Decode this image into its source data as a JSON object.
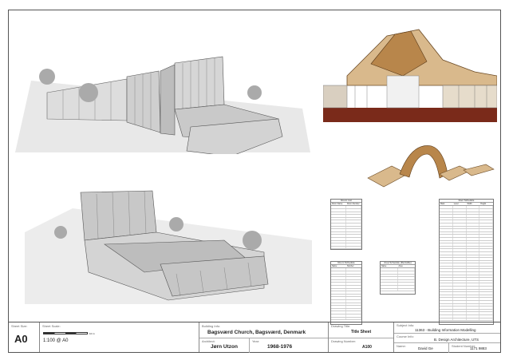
{
  "sheet": {
    "size_caption": "Sheet Size:",
    "size": "A0",
    "scale_caption": "Sheet Scale:",
    "scale": "1:100 @ A0",
    "scalebar_label": "10 m"
  },
  "building": {
    "caption": "Building Info:",
    "name": "Bagsværd Church, Bagsværd, Denmark",
    "architect_caption": "Architect:",
    "architect": "Jørn Utzon",
    "year_caption": "Year:",
    "year": "1968-1976"
  },
  "drawing": {
    "caption": "Drawing Title:",
    "title": "Title Sheet",
    "number_caption": "Drawing Number:",
    "number": "A100"
  },
  "subject": {
    "caption": "Subject Info:",
    "name": "11363 - Building Information Modelling",
    "course_caption": "Course Info:",
    "course": "B. Design Architecture, UTS",
    "name_caption": "Name:",
    "student": "David Ge",
    "id_caption": "Student Number:",
    "student_id": "1171 9883"
  },
  "tables": {
    "rooms": {
      "title": "Room List",
      "headers": [
        "Room Name",
        "Room Number"
      ],
      "rows": 17
    },
    "doors": {
      "title": "Door Schedule",
      "headers": [
        "Mark",
        "Level",
        "Width",
        "Height"
      ],
      "rows": 40
    },
    "furniture": {
      "title": "Room Schedule",
      "headers": [
        "Name",
        "Number"
      ],
      "rows": 18
    },
    "areas": {
      "title": "Area Schedule (Rentable)",
      "headers": [
        "Name",
        "Area"
      ],
      "rows": 8
    }
  },
  "colors": {
    "wood": "#b8864b",
    "roof": "#d9b98c",
    "interior_wall": "#7a2a1a",
    "line": "#555"
  }
}
